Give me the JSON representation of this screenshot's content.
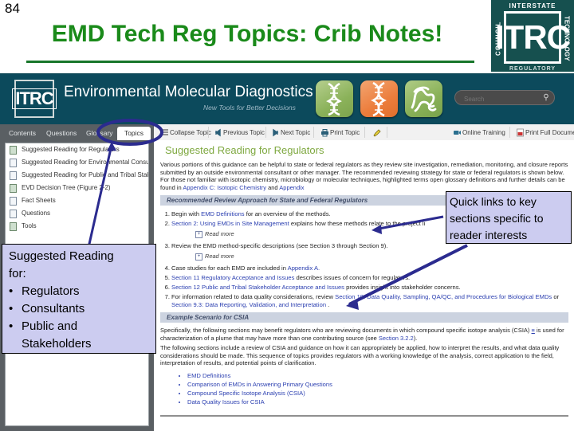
{
  "slide": {
    "number": "84",
    "title": "EMD Tech Reg Topics: Crib Notes!",
    "title_color": "#1a8a1a"
  },
  "corner_logo": {
    "top_text": "INTERSTATE",
    "left_text": "COUNCIL",
    "right_text": "TECHNOLOGY",
    "center_text": "ITRC",
    "bottom_text": "REGULATORY"
  },
  "app": {
    "banner": {
      "logo_text": "ITRC",
      "title": "Environmental Molecular Diagnostics",
      "tagline": "New Tools for Better Decisions",
      "icon_buttons": [
        {
          "name": "dna-helix-green-icon",
          "color": "#8bb25a"
        },
        {
          "name": "dna-helix-orange-icon",
          "color": "#ec7d3c"
        },
        {
          "name": "molecule-green-icon",
          "color": "#88b057"
        }
      ],
      "search": {
        "placeholder": "Search",
        "value": "",
        "icon": "search-icon"
      }
    },
    "tabs": [
      {
        "label": "Contents",
        "active": false
      },
      {
        "label": "Questions",
        "active": false
      },
      {
        "label": "Glossary",
        "active": false
      },
      {
        "label": "Topics",
        "active": true
      }
    ],
    "toolbar": [
      {
        "label": "Collapse Topic",
        "icon": "list-icon"
      },
      {
        "label": "Previous Topic",
        "icon": "arrow-left-icon"
      },
      {
        "label": "Next Topic",
        "icon": "arrow-right-icon"
      },
      {
        "label": "Print Topic",
        "icon": "printer-icon"
      },
      {
        "label": "",
        "icon": "highlighter-icon"
      },
      {
        "label": "Online Training",
        "icon": "video-icon"
      },
      {
        "label": "Print Full Document",
        "icon": "pdf-icon"
      }
    ],
    "sidebar_tree": [
      {
        "label": "Suggested Reading for Regulators",
        "type": "folder"
      },
      {
        "label": "Suggested Reading for Environmental Consulta",
        "type": "page"
      },
      {
        "label": "Suggested Reading for Public and Tribal Stakeh",
        "type": "page"
      },
      {
        "label": "EVD Decision Tree (Figure 2-2)",
        "type": "folder"
      },
      {
        "label": "Fact Sheets",
        "type": "page"
      },
      {
        "label": "Questions",
        "type": "page"
      },
      {
        "label": "Tools",
        "type": "folder"
      }
    ],
    "content": {
      "heading": "Suggested Reading for Regulators",
      "intro_paragraph": "Various portions of this guidance can be helpful to state or federal regulators as they review site investigation, remediation, monitoring, and closure reports submitted by an outside environmental consultant or other manager. The recommended reviewing strategy for state or federal regulators is shown below. For those not familiar with isotopic chemistry, microbiology or molecular techniques, highlighted terms open glossary definitions and further details can be found in ",
      "intro_link_1": "Appendix C: Isotopic Chemistry",
      "intro_join": " and ",
      "intro_link_2": "Appendix",
      "section_review_title": "Recommended Review Approach for State and Federal Regulators",
      "steps": [
        {
          "n": "1.",
          "pre": "Begin with ",
          "link": "EMD Definitions",
          "post": " for an overview of the methods."
        },
        {
          "n": "2.",
          "pre": "",
          "link": "Section 2: Using EMDs in Site Management",
          "post": " explains how these methods relate to the project li"
        },
        {
          "n": "3.",
          "pre": "Review the EMD method-specific descriptions (see Section 3 through Section 9).",
          "link": "",
          "post": ""
        },
        {
          "n": "4.",
          "pre": "Case studies for each EMD are included in ",
          "link": "Appendix A.",
          "post": ""
        },
        {
          "n": "5.",
          "pre": "",
          "link": "Section 11 Regulatory Acceptance and Issues",
          "post": " describes issues of concern for regulators."
        },
        {
          "n": "6.",
          "pre": "",
          "link": "Section 12 Public and Tribal Stakeholder Acceptance and Issues",
          "post": " provides insight into stakeholder concerns."
        },
        {
          "n": "7.",
          "pre": "For information related to data quality considerations, review ",
          "link": "Section 10: Data Quality, Sampling, QA/QC, and Procedures for Biological EMDs",
          "post": " or ",
          "link2": "Section 9.3: Data Reporting, Validation, and Interpretation",
          "post2": " ."
        }
      ],
      "read_more_label": "Read more",
      "section_example_title": "Example Scenario for CSIA",
      "example_paragraph_1": "Specifically, the following sections may benefit regulators who are reviewing documents in which compound specific isotope analysis (CSIA) ",
      "example_paragraph_1b": " is used for characterization of a plume that may have more than one contributing source (see ",
      "example_link": "Section 3.2.2",
      "example_paragraph_1c": ").",
      "example_paragraph_2": "The following sections include a review of CSIA and guidance on how it can appropriately be applied, how to interpret the results, and what data quality considerations should be made. This sequence of topics provides regulators with a working knowledge of the analysis, correct application to the field, interpretation of results, and potential points of clarification.",
      "bullet_links": [
        "EMD Definitions",
        "Comparison of EMDs in Answering Primary Questions",
        "Compound Specific Isotope Analysis (CSIA)",
        "Data Quality Issues for CSIA"
      ]
    }
  },
  "annotations": {
    "quick_links_callout": "Quick links to key sections specific to reader interests",
    "suggested_reading_callout": {
      "title_line_1": "Suggested Reading",
      "title_line_2": "for:",
      "bullets": [
        "Regulators",
        "Consultants",
        "Public and"
      ],
      "bullet_3_wrap": "Stakeholders"
    },
    "highlight_color": "#2b2b8f",
    "callout_fill": "#ccccf0"
  }
}
